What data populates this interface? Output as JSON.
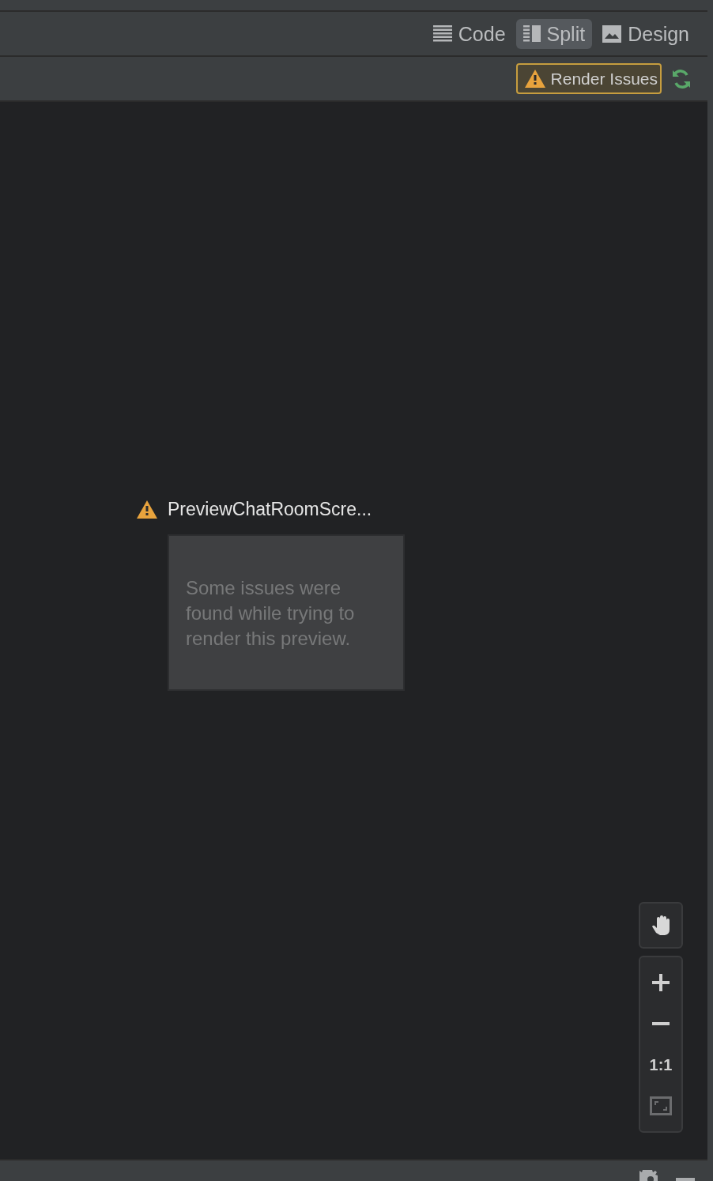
{
  "view_tabs": [
    {
      "label": "Code",
      "kind": "code",
      "selected": false
    },
    {
      "label": "Split",
      "kind": "split",
      "selected": true
    },
    {
      "label": "Design",
      "kind": "design",
      "selected": false
    }
  ],
  "render_issues_button": {
    "label": "Render Issues"
  },
  "preview": {
    "title": "PreviewChatRoomScre...",
    "message": "Some issues were found while trying to render this preview."
  },
  "zoom_controls": [
    {
      "kind": "plus"
    },
    {
      "kind": "minus"
    },
    {
      "kind": "actual",
      "label": "1:1"
    },
    {
      "kind": "fit"
    }
  ]
}
